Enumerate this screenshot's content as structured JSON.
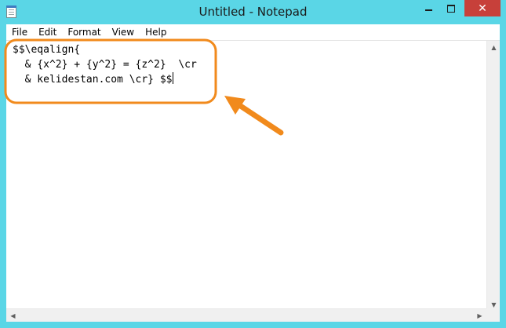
{
  "window": {
    "title": "Untitled - Notepad",
    "frame_color": "#5ad6e6",
    "close_color": "#c7403a",
    "icon": "notepad-icon"
  },
  "controls": {
    "minimize_icon": "minimize-icon",
    "maximize_icon": "maximize-icon",
    "close_icon": "close-icon",
    "close_glyph": "✕"
  },
  "menu": {
    "items": [
      "File",
      "Edit",
      "Format",
      "View",
      "Help"
    ]
  },
  "editor": {
    "lines": [
      "$$\\eqalign{",
      "  & {x^2} + {y^2} = {z^2}  \\cr",
      "  & kelidestan.com \\cr} $$"
    ]
  },
  "annotation": {
    "color": "#f18a1c",
    "shapes": [
      "rounded-rectangle-highlight",
      "arrow"
    ]
  },
  "scrollbars": {
    "up_glyph": "▲",
    "down_glyph": "▼",
    "left_glyph": "◀",
    "right_glyph": "▶"
  }
}
